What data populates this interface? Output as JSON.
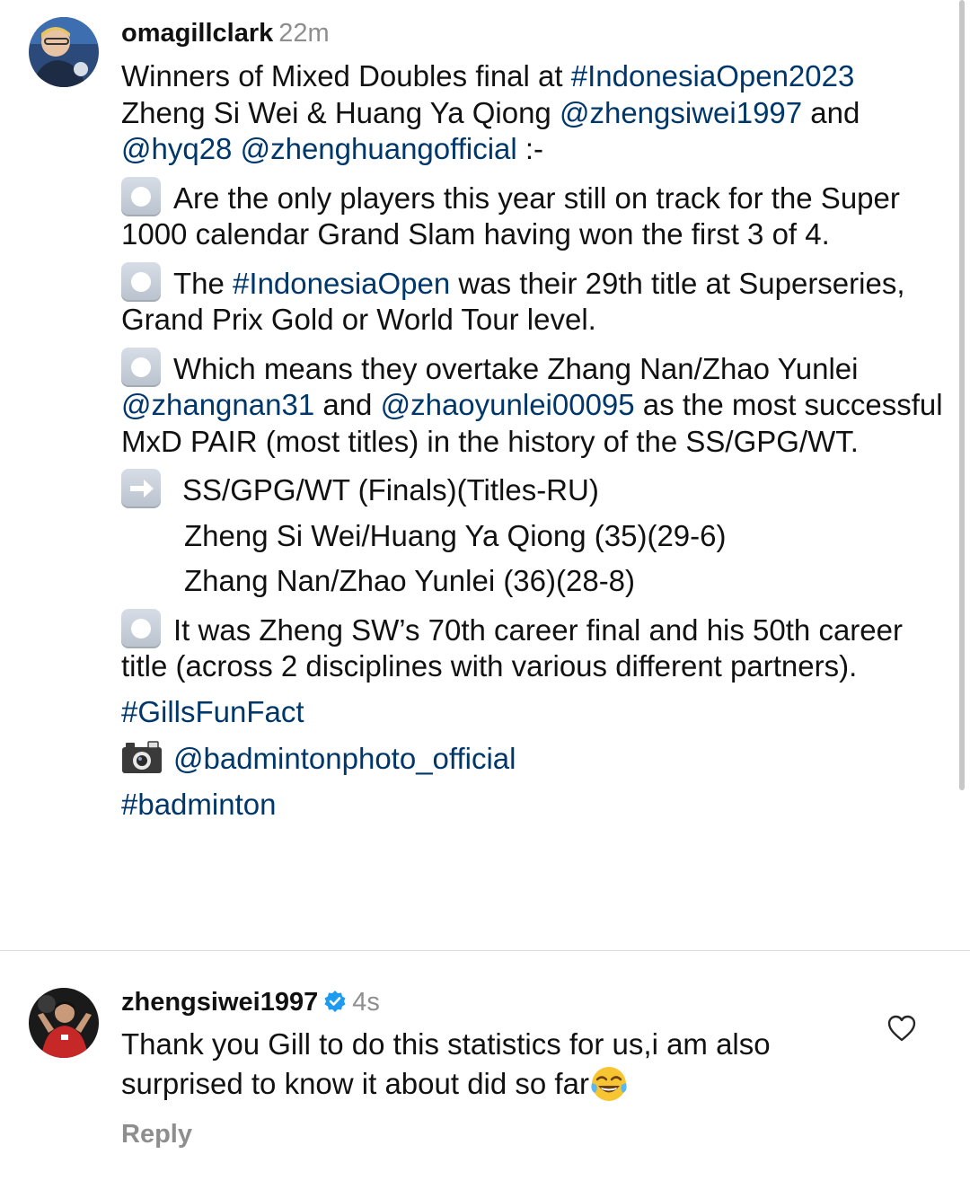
{
  "post": {
    "username": "omagillclark",
    "time": "22m",
    "caption": {
      "intro": {
        "t1": "Winners of Mixed Doubles final at ",
        "tag1": "#IndonesiaOpen2023",
        "t2": " Zheng Si Wei & Huang Ya Qiong ",
        "mention1": "@zhengsiwei1997",
        "t3": " and ",
        "mention2": "@hyq28",
        "t4": " ",
        "mention3": "@zhenghuangofficial",
        "t5": " :-"
      },
      "fact1": "Are the only players this year still on track for the Super 1000 calendar Grand Slam having won the first 3 of 4.",
      "fact2": {
        "t1": "The ",
        "tag": "#IndonesiaOpen",
        "t2": " was their 29th title at Superseries, Grand Prix Gold or World Tour level."
      },
      "fact3": {
        "t1": "Which means they overtake Zhang Nan/Zhao Yunlei ",
        "mention1": "@zhangnan31",
        "t2": " and ",
        "mention2": "@zhaoyunlei00095",
        "t3": " as the most successful MxD PAIR (most titles) in the history of the SS/GPG/WT."
      },
      "stats": {
        "header": "SS/GPG/WT (Finals)(Titles-RU)",
        "row1": "Zheng Si Wei/Huang Ya Qiong (35)(29-6)",
        "row2": "Zhang Nan/Zhao Yunlei (36)(28-8)"
      },
      "fact4": "It was Zheng SW’s 70th career final and his 50th career title (across 2 disciplines with various different partners).",
      "hashtag_funfact": "#GillsFunFact",
      "photo_credit": "@badmintonphoto_official",
      "hashtag_badminton": "#badminton"
    }
  },
  "comment": {
    "username": "zhengsiwei1997",
    "time": "4s",
    "text": "Thank you Gill to do this statistics for us,i am also surprised to know it about did so far",
    "reply_label": "Reply"
  },
  "icons": {
    "bullet": "white-circle-button-emoji",
    "arrow": "right-arrow-emoji",
    "camera": "camera-with-flash-emoji",
    "verified": "verified-badge-icon",
    "laugh": "face-with-tears-of-joy-emoji",
    "like": "heart-outline-icon"
  },
  "colors": {
    "link": "#00376b",
    "secondary_text": "#8e8e8e",
    "verified": "#1d9bf0",
    "divider": "#dbdbdb"
  }
}
